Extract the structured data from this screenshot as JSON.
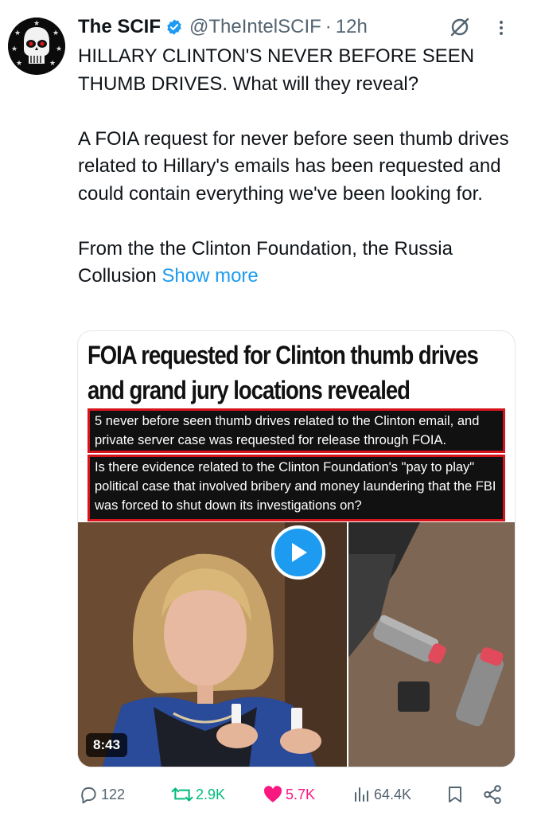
{
  "author": {
    "name": "The SCIF",
    "handle": "@TheIntelSCIF",
    "separator": "·",
    "time": "12h",
    "verified": true
  },
  "tweet": {
    "paragraph1": "HILLARY CLINTON'S NEVER BEFORE SEEN THUMB DRIVES. What will they reveal?",
    "paragraph2": "A FOIA request for never before seen thumb drives related to Hillary's emails has been requested and could contain everything we've been looking for.",
    "paragraph3": "From the the Clinton Foundation, the Russia Collusion",
    "show_more": "Show more"
  },
  "media": {
    "title_line1": "FOIA requested for Clinton thumb drives",
    "title_line2": "and grand jury locations revealed",
    "box1": "5 never before seen thumb drives related to the Clinton email, and private server case was requested for release through FOIA.",
    "box2": "Is there evidence related to the Clinton Foundation's \"pay to play\" political case that involved bribery and money laundering that the FBI was forced to shut down its investigations on?",
    "duration": "8:43"
  },
  "actions": {
    "replies": "122",
    "reposts": "2.9K",
    "likes": "5.7K",
    "views": "64.4K"
  },
  "colors": {
    "accent": "#1d9bf0",
    "retweet": "#00ba7c",
    "like": "#f91880",
    "muted": "#536471",
    "box_border": "#d7141c"
  },
  "icons": [
    "avatar-skull",
    "verified-badge-icon",
    "grok-icon",
    "more-icon",
    "play-icon",
    "reply-icon",
    "retweet-icon",
    "heart-icon",
    "views-icon",
    "bookmark-icon",
    "share-icon"
  ]
}
